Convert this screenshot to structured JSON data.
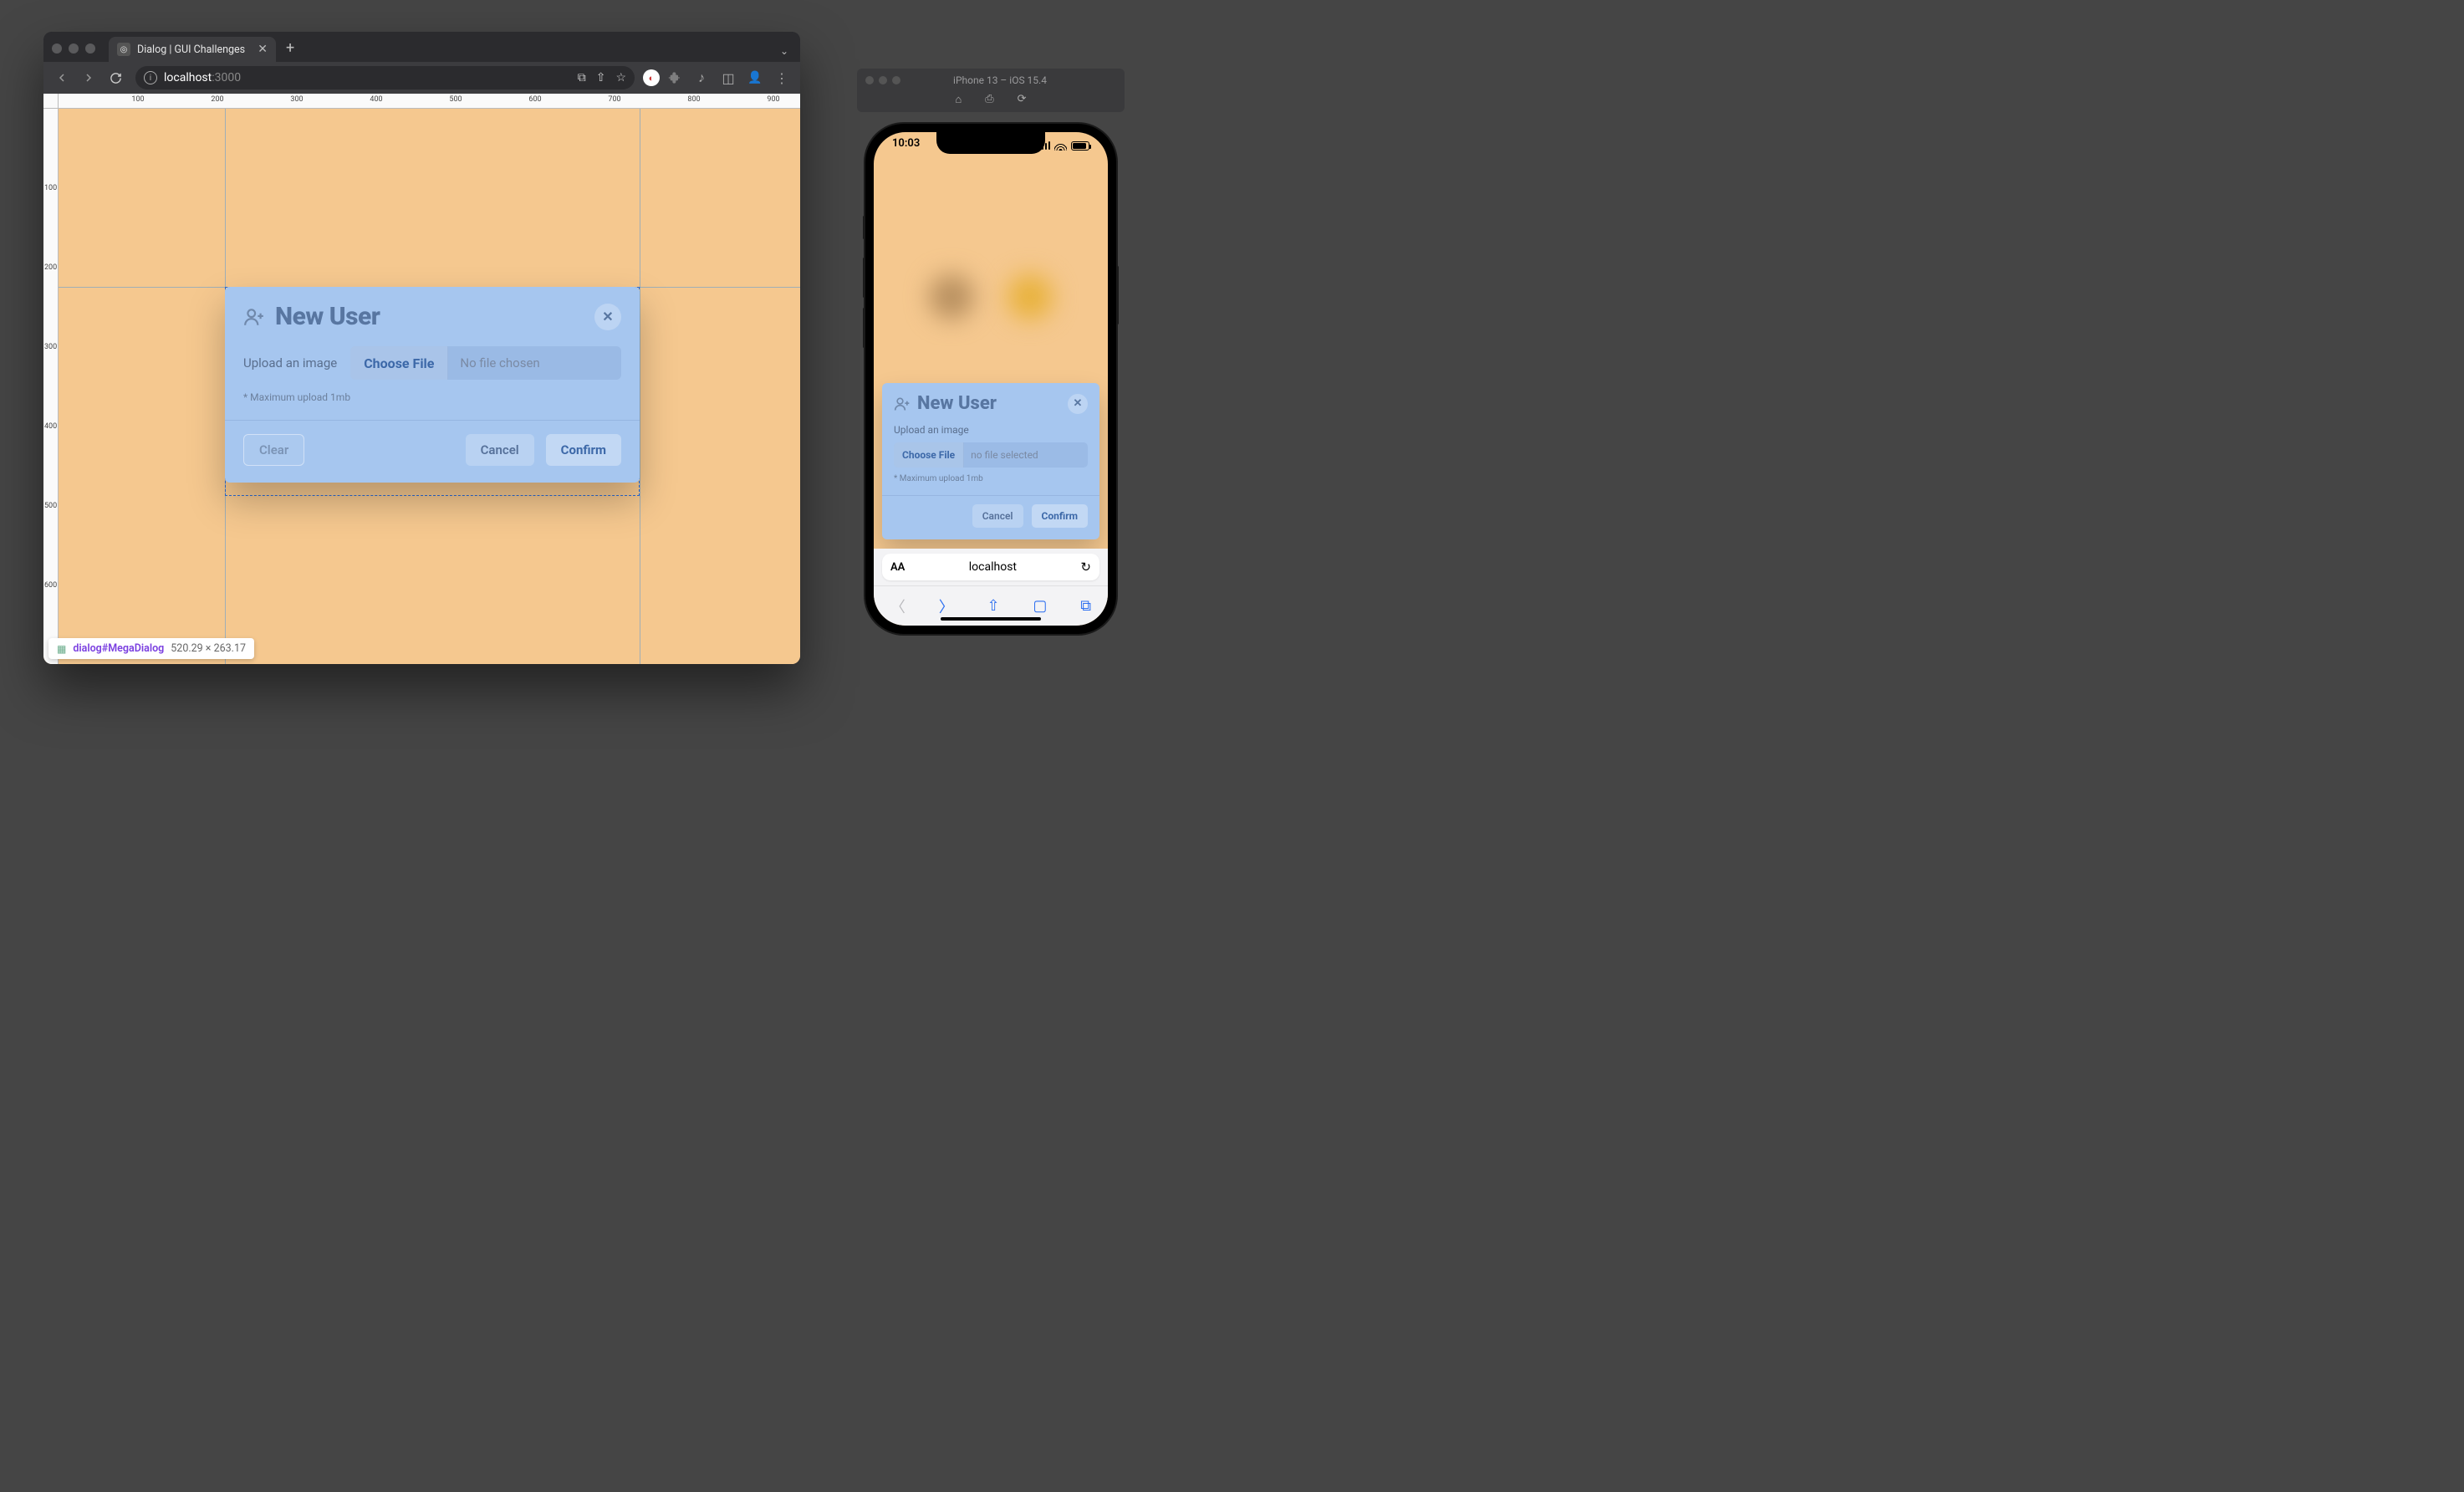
{
  "browser": {
    "tab_title": "Dialog | GUI Challenges",
    "url_host": "localhost",
    "url_port": ":3000",
    "ruler_h": [
      "100",
      "200",
      "300",
      "400",
      "500",
      "600",
      "700",
      "800",
      "900"
    ],
    "ruler_v": [
      "100",
      "200",
      "300",
      "400",
      "500",
      "600"
    ]
  },
  "dialog": {
    "title": "New User",
    "upload_label": "Upload an image",
    "choose_file": "Choose File",
    "no_file": "No file chosen",
    "hint": "* Maximum upload 1mb",
    "clear": "Clear",
    "cancel": "Cancel",
    "confirm": "Confirm"
  },
  "inspect": {
    "selector": "dialog#MegaDialog",
    "dims": "520.29 × 263.17"
  },
  "simulator": {
    "title": "iPhone 13 – iOS 15.4",
    "time": "10:03"
  },
  "mobile_dialog": {
    "title": "New User",
    "upload_label": "Upload an image",
    "choose_file": "Choose File",
    "no_file": "no file selected",
    "hint": "* Maximum upload 1mb",
    "cancel": "Cancel",
    "confirm": "Confirm"
  },
  "safari": {
    "host": "localhost"
  }
}
